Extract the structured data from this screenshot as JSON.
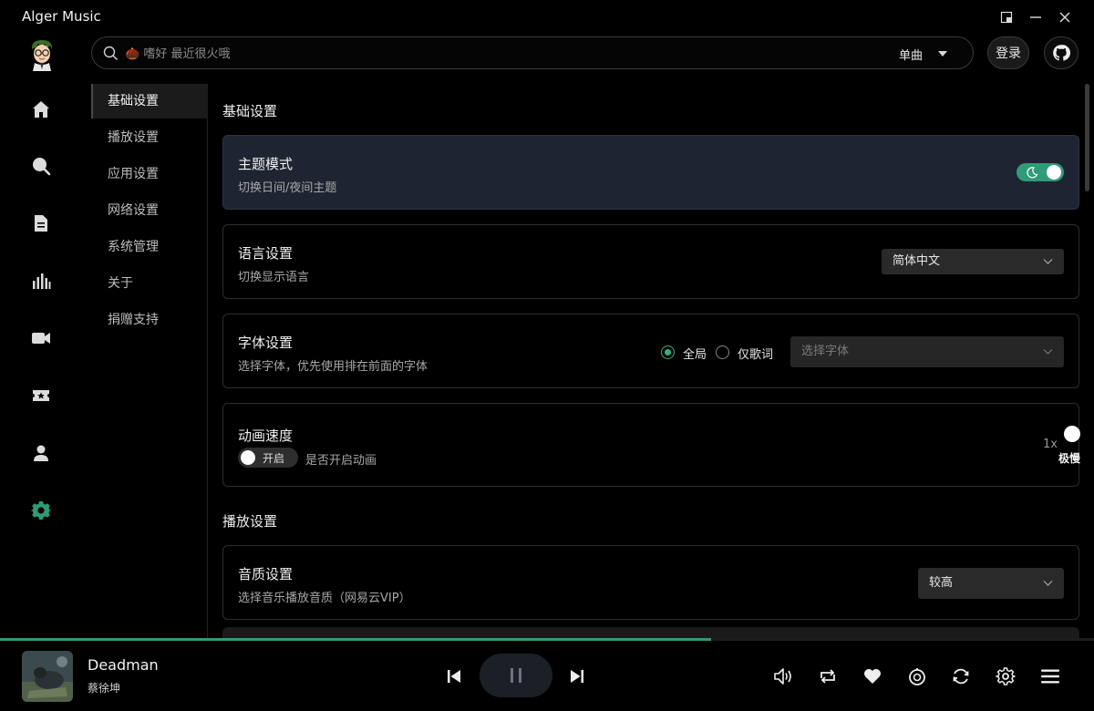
{
  "app": {
    "title": "Alger Music"
  },
  "search": {
    "placeholder": "🌰 嗜好 最近很火哦",
    "type_label": "单曲"
  },
  "header": {
    "login_label": "登录"
  },
  "settings_nav": {
    "items": [
      {
        "label": "基础设置",
        "active": true
      },
      {
        "label": "播放设置",
        "active": false
      },
      {
        "label": "应用设置",
        "active": false
      },
      {
        "label": "网络设置",
        "active": false
      },
      {
        "label": "系统管理",
        "active": false
      },
      {
        "label": "关于",
        "active": false
      },
      {
        "label": "捐赠支持",
        "active": false
      }
    ]
  },
  "sections": {
    "basic": {
      "title": "基础设置",
      "theme": {
        "title": "主题模式",
        "desc": "切换日间/夜间主题",
        "enabled": true
      },
      "language": {
        "title": "语言设置",
        "desc": "切换显示语言",
        "value": "简体中文"
      },
      "font": {
        "title": "字体设置",
        "desc": "选择字体，优先使用排在前面的字体",
        "scope_global": "全局",
        "scope_lyrics": "仅歌词",
        "placeholder": "选择字体"
      },
      "animation": {
        "title": "动画速度",
        "toggle_label": "开启",
        "desc": "是否开启动画",
        "speed": "1x",
        "clipped_label": "极慢"
      }
    },
    "playback": {
      "title": "播放设置",
      "quality": {
        "title": "音质设置",
        "desc": "选择音乐播放音质（网易云VIP）",
        "value": "较高"
      }
    }
  },
  "player": {
    "song_title": "Deadman",
    "artist": "蔡徐坤",
    "progress": 0.65
  },
  "colors": {
    "accent": "#2f9b77",
    "highlight_card": "#1e2431"
  },
  "icons": {
    "nav": [
      "home-icon",
      "search-icon",
      "playlist-icon",
      "chart-icon",
      "video-icon",
      "ticket-icon",
      "user-icon",
      "settings-icon"
    ],
    "player": [
      "prev-icon",
      "pause-icon",
      "next-icon",
      "volume-icon",
      "repeat-icon",
      "heart-icon",
      "timer-icon",
      "refresh-icon",
      "gear-icon",
      "menu-icon"
    ]
  }
}
